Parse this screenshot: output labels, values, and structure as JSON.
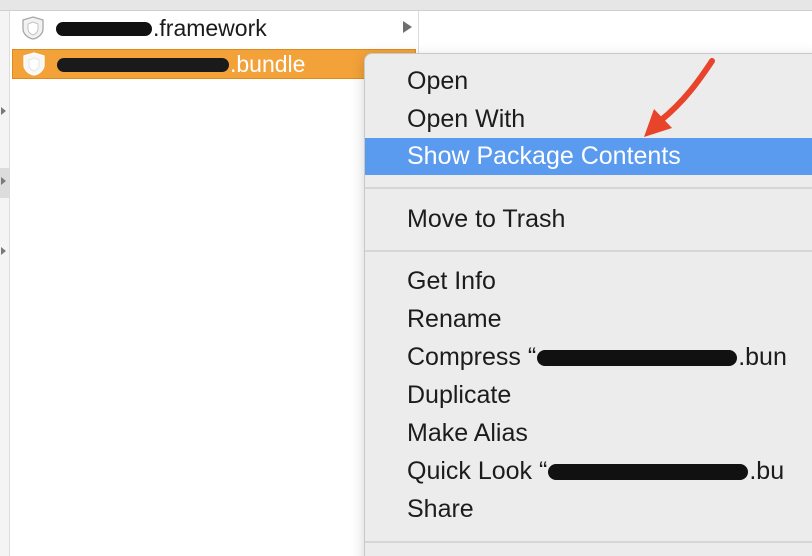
{
  "finder": {
    "rows": [
      {
        "suffix": ".framework"
      },
      {
        "suffix": ".bundle"
      }
    ]
  },
  "context_menu": {
    "items": [
      "Open",
      "Open With",
      "Show Package Contents",
      "Move to Trash",
      "Get Info",
      "Rename",
      "Duplicate",
      "Make Alias",
      "Share"
    ],
    "compress": {
      "prefix": "Compress “",
      "suffix": ".bun"
    },
    "quicklook": {
      "prefix": "Quick Look “",
      "suffix": ".bu"
    },
    "highlight_color": "#5a9bf0"
  },
  "selection_color": "#f3a23a",
  "annotation_color": "#e8432b"
}
